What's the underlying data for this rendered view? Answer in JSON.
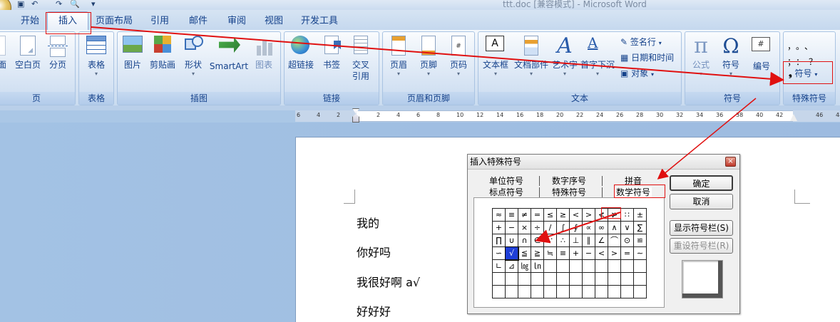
{
  "window": {
    "title": "ttt.doc [兼容模式] - Microsoft Word"
  },
  "tabs": [
    {
      "label": "开始"
    },
    {
      "label": "插入"
    },
    {
      "label": "页面布局"
    },
    {
      "label": "引用"
    },
    {
      "label": "邮件"
    },
    {
      "label": "审阅"
    },
    {
      "label": "视图"
    },
    {
      "label": "开发工具"
    }
  ],
  "ribbon": {
    "pages": {
      "label": "页",
      "buttons": [
        "面",
        "空白页",
        "分页"
      ]
    },
    "table": {
      "label": "表格",
      "buttons": [
        "表格"
      ]
    },
    "illustrations": {
      "label": "插图",
      "buttons": [
        "图片",
        "剪贴画",
        "形状",
        "SmartArt",
        "图表"
      ]
    },
    "links": {
      "label": "链接",
      "buttons": [
        "超链接",
        "书签",
        "交叉\n引用"
      ],
      "crossref_1": "交叉",
      "crossref_2": "引用"
    },
    "header_footer": {
      "label": "页眉和页脚",
      "buttons": [
        "页眉",
        "页脚",
        "页码"
      ]
    },
    "text": {
      "label": "文本",
      "buttons": [
        "文本框",
        "文档部件",
        "艺术字",
        "首字下沉"
      ],
      "small": [
        "签名行",
        "日期和时间",
        "对象"
      ]
    },
    "symbols": {
      "label": "符号",
      "buttons": [
        "公式",
        "符号",
        "编号"
      ]
    },
    "special": {
      "label": "特殊符号",
      "button": "符号",
      "glyphs": "，。、 ；：？"
    }
  },
  "ruler": {
    "ticks": [
      "6",
      "4",
      "2",
      "2",
      "4",
      "6",
      "8",
      "10",
      "12",
      "14",
      "16",
      "18",
      "20",
      "22",
      "24",
      "26",
      "28",
      "30",
      "32",
      "34",
      "36",
      "38",
      "40",
      "42",
      "46",
      "48"
    ]
  },
  "document": {
    "lines": [
      "我的",
      "你好吗",
      "我很好啊 a√",
      "好好好"
    ]
  },
  "dialog": {
    "title": "插入特殊符号",
    "close": "×",
    "tabs_row1": [
      "单位符号",
      "数字序号",
      "拼音"
    ],
    "tabs_row2": [
      "标点符号",
      "特殊符号",
      "数学符号"
    ],
    "grid": [
      [
        "≈",
        "≡",
        "≠",
        "=",
        "≤",
        "≥",
        "<",
        ">",
        "≮",
        "≯",
        "∷",
        "±"
      ],
      [
        "+",
        "−",
        "×",
        "÷",
        "/",
        "∫",
        "∮",
        "∝",
        "∞",
        "∧",
        "∨",
        "∑"
      ],
      [
        "∏",
        "∪",
        "∩",
        "∈",
        "∵",
        "∴",
        "⊥",
        "∥",
        "∠",
        "⌒",
        "⊙",
        "≌"
      ],
      [
        "∽",
        "√",
        "≦",
        "≧",
        "≒",
        "≡",
        "+",
        "−",
        "<",
        ">",
        "=",
        "∼"
      ],
      [
        "∟",
        "⊿",
        "㏒",
        "㏑",
        "",
        "",
        "",
        "",
        "",
        "",
        "",
        ""
      ],
      [
        "",
        "",
        "",
        "",
        "",
        "",
        "",
        "",
        "",
        "",
        "",
        ""
      ],
      [
        "",
        "",
        "",
        "",
        "",
        "",
        "",
        "",
        "",
        "",
        "",
        ""
      ]
    ],
    "selected": "√",
    "buttons": {
      "ok": "确定",
      "cancel": "取消",
      "show_bar": "显示符号栏(S)",
      "reset_bar": "重设符号栏(R)"
    }
  },
  "colors": {
    "annotation": "#e01010",
    "ribbon_text": "#15428b",
    "selected_cell": "#1f3fd8"
  }
}
